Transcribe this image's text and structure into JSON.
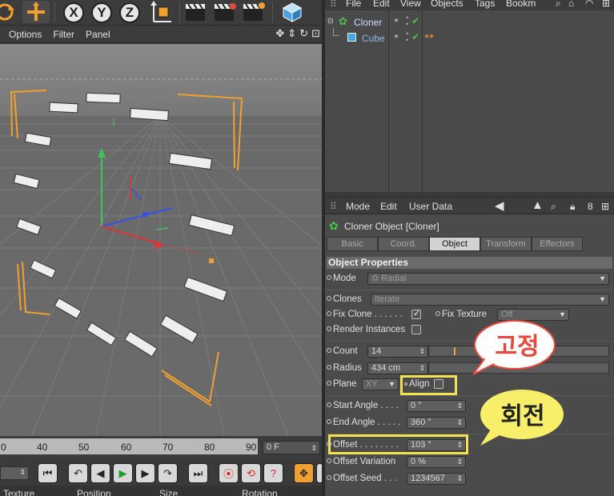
{
  "toolbar": {
    "buttons": [
      "undo-icon",
      "move-icon",
      "x-axis-lock",
      "y-axis-lock",
      "z-axis-lock",
      "world-axis-icon",
      "render-view-icon",
      "render-picture-icon",
      "render-settings-icon",
      "cube-icon"
    ],
    "axis_x": "X",
    "axis_y": "Y",
    "axis_z": "Z"
  },
  "viewport_menu": {
    "options": "Options",
    "filter": "Filter",
    "panel": "Panel"
  },
  "timeline": {
    "ticks": [
      "0",
      "40",
      "50",
      "60",
      "70",
      "80",
      "90"
    ],
    "frame": "0 F"
  },
  "bottom_header": {
    "texture": "Texture",
    "position": "Position",
    "size": "Size",
    "rotation": "Rotation"
  },
  "object_manager": {
    "menu": [
      "File",
      "Edit",
      "View",
      "Objects",
      "Tags",
      "Bookm"
    ],
    "objects": [
      {
        "name": "Cloner",
        "icon": "cloner-icon"
      },
      {
        "name": "Cube",
        "icon": "cube-icon"
      }
    ]
  },
  "attribute_manager": {
    "menu": {
      "mode": "Mode",
      "edit": "Edit",
      "user_data": "User Data"
    },
    "title": "Cloner Object [Cloner]",
    "tabs": [
      "Basic",
      "Coord.",
      "Object",
      "Transform",
      "Effectors"
    ],
    "active_tab": "Object",
    "section": "Object Properties",
    "mode": {
      "label": "Mode",
      "value": "Radial"
    },
    "clones": {
      "label": "Clones",
      "value": "Iterate"
    },
    "fix_clone": {
      "label": "Fix Clone . . . . . .",
      "checked": true
    },
    "fix_texture": {
      "label": "Fix Texture",
      "value": "Off"
    },
    "render_instances": {
      "label": "Render Instances",
      "checked": false
    },
    "count": {
      "label": "Count",
      "value": "14",
      "slider_fraction": 0.14
    },
    "radius": {
      "label": "Radius",
      "value": "434 cm"
    },
    "plane": {
      "label": "Plane",
      "value": "XY"
    },
    "align": {
      "label": "Align",
      "checked": false
    },
    "start_angle": {
      "label": "Start Angle . . . .",
      "value": "0 °"
    },
    "end_angle": {
      "label": "End Angle . . . . .",
      "value": "360 °"
    },
    "offset": {
      "label": "Offset . . . . . . . .",
      "value": "103 °"
    },
    "offset_variation": {
      "label": "Offset Variation",
      "value": "0 %"
    },
    "offset_seed": {
      "label": "Offset Seed . . .",
      "value": "1234567"
    }
  },
  "annotations": {
    "fixed": "고정",
    "rotation": "회전"
  },
  "colors": {
    "highlight": "#f2e24e",
    "bubble_red": "#e8473c",
    "bubble_yellow": "#f7ee6a",
    "accent_orange": "#f0a030"
  }
}
